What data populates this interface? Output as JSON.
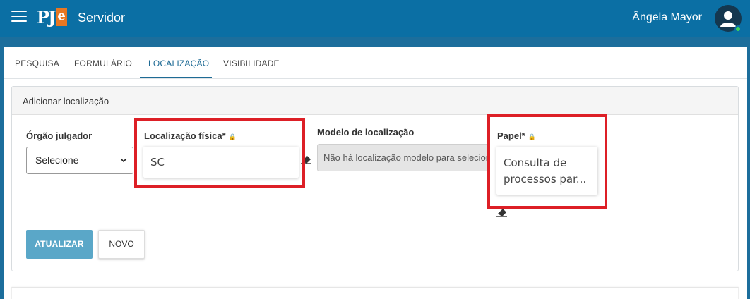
{
  "header": {
    "logo_p": "PJ",
    "logo_e": "e",
    "app_title": "Servidor",
    "user_name": "Ângela Mayor"
  },
  "tabs": [
    {
      "label": "PESQUISA",
      "active": false
    },
    {
      "label": "FORMULÁRIO",
      "active": false
    },
    {
      "label": "LOCALIZAÇÃO",
      "active": true
    },
    {
      "label": "VISIBILIDADE",
      "active": false
    }
  ],
  "panel": {
    "title": "Adicionar localização",
    "orgao": {
      "label": "Órgão julgador",
      "selected": "Selecione"
    },
    "localizacao": {
      "label": "Localização física*",
      "value": "SC"
    },
    "modelo": {
      "label": "Modelo de localização",
      "value": "Não há localização modelo para selecionar"
    },
    "papel": {
      "label": "Papel*",
      "value_line1": "Consulta de",
      "value_line2": "processos par..."
    }
  },
  "buttons": {
    "atualizar": "ATUALIZAR",
    "novo": "NOVO"
  },
  "colors": {
    "header": "#0b6fa4",
    "accent": "#1e6b95",
    "primary_button": "#5aa7c8",
    "highlight": "#dd1f26",
    "online": "#3ed45a"
  }
}
